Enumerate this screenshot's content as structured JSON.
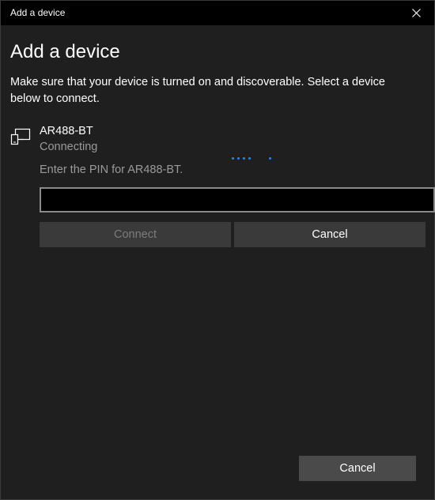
{
  "window": {
    "title": "Add a device"
  },
  "dialog": {
    "heading": "Add a device",
    "instructions": "Make sure that your device is turned on and discoverable. Select a device below to connect."
  },
  "device": {
    "icon": "device-icon",
    "name": "AR488-BT",
    "status": "Connecting",
    "pin_prompt": "Enter the PIN for AR488-BT.",
    "pin_value": "",
    "connect_label": "Connect",
    "cancel_label": "Cancel"
  },
  "footer": {
    "cancel_label": "Cancel"
  },
  "colors": {
    "accent": "#1e88ff",
    "background": "#1f1f1f",
    "titlebar": "#000000"
  }
}
